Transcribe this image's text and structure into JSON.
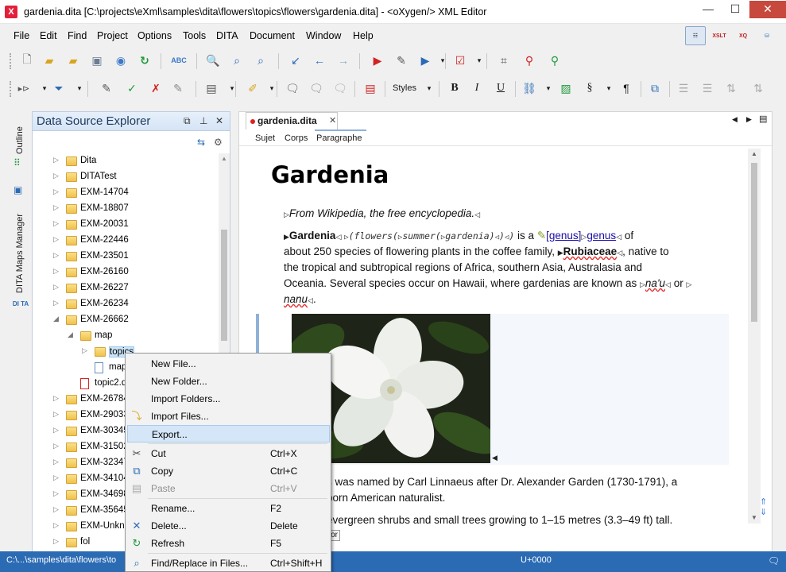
{
  "window": {
    "title": "gardenia.dita [C:\\projects\\eXml\\samples\\dita\\flowers\\topics\\flowers\\gardenia.dita] - <oXygen/> XML Editor",
    "controls": {
      "minimize": "—",
      "maximize": "☐",
      "close": "✕"
    }
  },
  "menu": [
    "File",
    "Edit",
    "Find",
    "Project",
    "Options",
    "Tools",
    "DITA",
    "Document",
    "Window",
    "Help"
  ],
  "perspectives": [
    "editor",
    "XSLT",
    "XQ",
    "db"
  ],
  "toolbar2": {
    "styles_label": "Styles"
  },
  "side_tabs": {
    "outline": "Outline",
    "dita_maps": "DITA Maps Manager",
    "dita_logo": "DI TA"
  },
  "explorer": {
    "title": "Data Source Explorer",
    "tree": [
      {
        "label": "Dita",
        "kind": "folder",
        "expanded": false,
        "level": 0
      },
      {
        "label": "DITATest",
        "kind": "folder",
        "expanded": false,
        "level": 0
      },
      {
        "label": "EXM-14704",
        "kind": "folder",
        "expanded": false,
        "level": 0
      },
      {
        "label": "EXM-18807",
        "kind": "folder",
        "expanded": false,
        "level": 0
      },
      {
        "label": "EXM-20031",
        "kind": "folder",
        "expanded": false,
        "level": 0
      },
      {
        "label": "EXM-22446",
        "kind": "folder",
        "expanded": false,
        "level": 0
      },
      {
        "label": "EXM-23501",
        "kind": "folder",
        "expanded": false,
        "level": 0
      },
      {
        "label": "EXM-26160",
        "kind": "folder",
        "expanded": false,
        "level": 0
      },
      {
        "label": "EXM-26227",
        "kind": "folder",
        "expanded": false,
        "level": 0
      },
      {
        "label": "EXM-26234",
        "kind": "folder",
        "expanded": false,
        "level": 0
      },
      {
        "label": "EXM-26662",
        "kind": "folder",
        "expanded": true,
        "level": 0
      },
      {
        "label": "map",
        "kind": "folder",
        "expanded": true,
        "level": 1
      },
      {
        "label": "topics",
        "kind": "folder",
        "expanded": false,
        "level": 2,
        "selected": true
      },
      {
        "label": "map",
        "kind": "file",
        "level": 2
      },
      {
        "label": "topic2.d",
        "kind": "xml",
        "level": 1
      },
      {
        "label": "EXM-26784",
        "kind": "folder",
        "expanded": false,
        "level": 0
      },
      {
        "label": "EXM-29033",
        "kind": "folder",
        "expanded": false,
        "level": 0
      },
      {
        "label": "EXM-30345",
        "kind": "folder",
        "expanded": false,
        "level": 0
      },
      {
        "label": "EXM-31502",
        "kind": "folder",
        "expanded": false,
        "level": 0
      },
      {
        "label": "EXM-32347",
        "kind": "folder",
        "expanded": false,
        "level": 0
      },
      {
        "label": "EXM-34104",
        "kind": "folder",
        "expanded": false,
        "level": 0
      },
      {
        "label": "EXM-34698",
        "kind": "folder",
        "expanded": false,
        "level": 0
      },
      {
        "label": "EXM-35645",
        "kind": "folder",
        "expanded": false,
        "level": 0
      },
      {
        "label": "EXM-Unkno",
        "kind": "folder",
        "expanded": false,
        "level": 0
      },
      {
        "label": "fol",
        "kind": "folder",
        "expanded": false,
        "level": 0
      }
    ]
  },
  "editor": {
    "tab_label": "gardenia.dita",
    "breadcrumbs": [
      "Sujet",
      "Corps",
      "Paragraphe"
    ],
    "heading": "Gardenia",
    "p1": "From Wikipedia, the free encyclopedia.",
    "p2": {
      "term": "Gardenia",
      "code1": "flowers",
      "code2": "summer",
      "code3": "gardenia",
      "is_a": "is a",
      "xref_text": "[genus]",
      "genus": "genus",
      "of": "of",
      "line2a": "about 250 species of flowering plants in the coffee family,",
      "family": "Rubiaceae",
      "line2b": ", native to",
      "line3": "the tropical and subtropical regions of Africa, southern Asia, Australasia and",
      "line4a": "Oceania. Several species occur on Hawaii, where gardenias are known as",
      "naau": "na'u",
      "or": "or",
      "nanu": "nanu",
      "dot": "."
    },
    "p3_line1": "s was named by Carl Linnaeus after Dr. Alexander Garden (1730-1791), a",
    "p3_line2": "born American naturalist.",
    "p4_line1": "evergreen shrubs and small trees growing to 1–15 metres (3.3–49 ft) tall.",
    "hidden_btn": "or"
  },
  "status": {
    "path": "C:\\...\\samples\\dita\\flowers\\to",
    "unicode": "U+0000"
  },
  "context_menu": [
    {
      "label": "New File...",
      "shortcut": "",
      "icon": "",
      "state": "normal"
    },
    {
      "label": "New Folder...",
      "shortcut": "",
      "icon": "",
      "state": "normal"
    },
    {
      "label": "Import Folders...",
      "shortcut": "",
      "icon": "",
      "state": "normal"
    },
    {
      "label": "Import Files...",
      "shortcut": "",
      "icon": "import-icon",
      "state": "normal"
    },
    {
      "label": "Export...",
      "shortcut": "",
      "icon": "",
      "state": "highlighted"
    },
    {
      "label": "Cut",
      "shortcut": "Ctrl+X",
      "icon": "scissors-icon",
      "state": "normal"
    },
    {
      "label": "Copy",
      "shortcut": "Ctrl+C",
      "icon": "copy-icon",
      "state": "normal"
    },
    {
      "label": "Paste",
      "shortcut": "Ctrl+V",
      "icon": "paste-icon",
      "state": "disabled"
    },
    {
      "label": "Rename...",
      "shortcut": "F2",
      "icon": "",
      "state": "normal"
    },
    {
      "label": "Delete...",
      "shortcut": "Delete",
      "icon": "delete-icon",
      "state": "normal"
    },
    {
      "label": "Refresh",
      "shortcut": "F5",
      "icon": "refresh-icon",
      "state": "normal"
    },
    {
      "label": "Find/Replace in Files...",
      "shortcut": "Ctrl+Shift+H",
      "icon": "find-in-files-icon",
      "state": "normal"
    }
  ],
  "colors": {
    "status_bar": "#2b6bb4",
    "accent_red": "#d22222",
    "link": "#1a0dab"
  }
}
